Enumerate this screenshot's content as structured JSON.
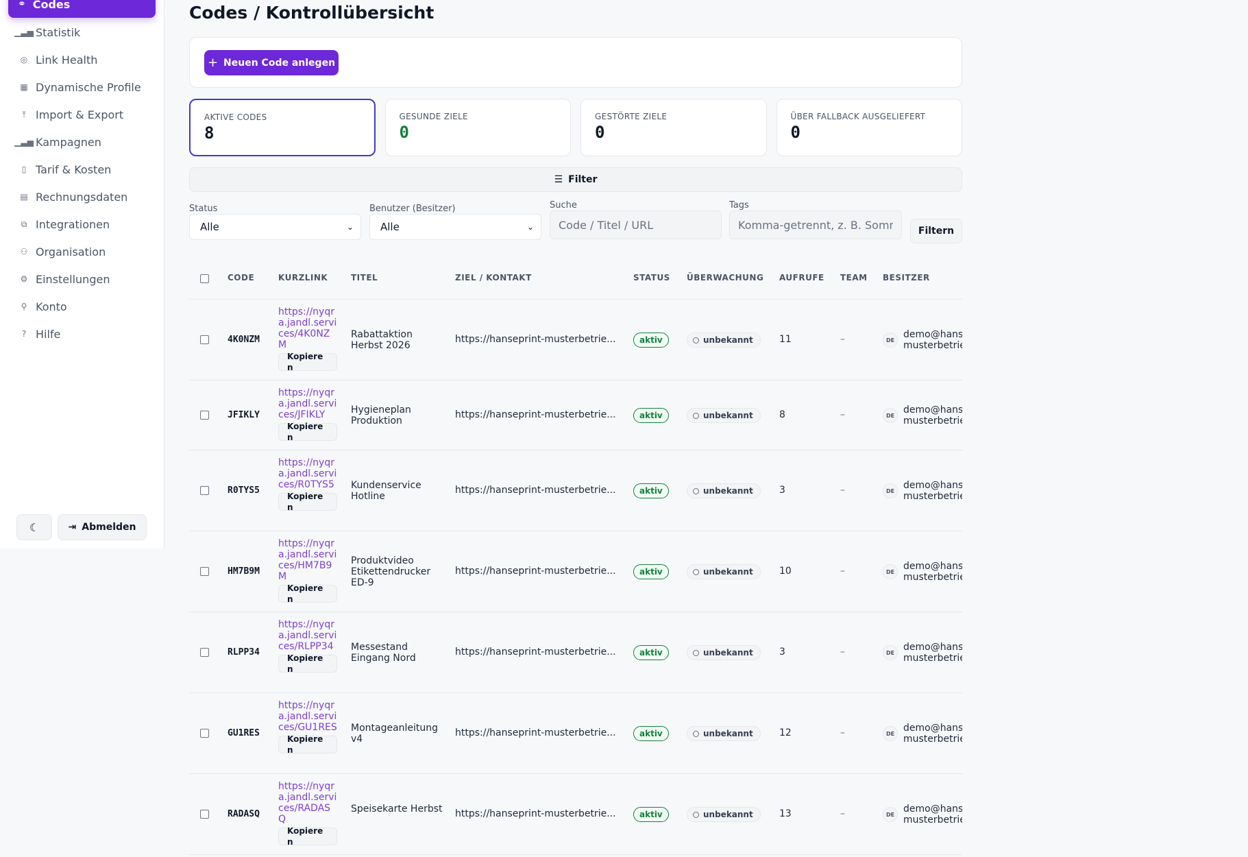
{
  "sidebar": {
    "active": {
      "label": "Codes",
      "icon": "link-icon"
    },
    "items": [
      {
        "label": "Statistik",
        "icon": "bar-chart-icon",
        "glyph": "▁▃▅"
      },
      {
        "label": "Link Health",
        "icon": "map-pin-icon",
        "glyph": "◎"
      },
      {
        "label": "Dynamische Profile",
        "icon": "grid-icon",
        "glyph": "▦"
      },
      {
        "label": "Import & Export",
        "icon": "upload-icon",
        "glyph": "⤒"
      },
      {
        "label": "Kampagnen",
        "icon": "bar-chart-icon",
        "glyph": "▁▃▅"
      },
      {
        "label": "Tarif & Kosten",
        "icon": "building-icon",
        "glyph": "▯"
      },
      {
        "label": "Rechnungsdaten",
        "icon": "document-icon",
        "glyph": "▤"
      },
      {
        "label": "Integrationen",
        "icon": "external-link-icon",
        "glyph": "⧉"
      },
      {
        "label": "Organisation",
        "icon": "users-icon",
        "glyph": "⚇"
      },
      {
        "label": "Einstellungen",
        "icon": "gear-icon",
        "glyph": "⚙"
      },
      {
        "label": "Konto",
        "icon": "user-icon",
        "glyph": "⚲"
      },
      {
        "label": "Hilfe",
        "icon": "help-icon",
        "glyph": "?"
      }
    ],
    "logout_label": "Abmelden"
  },
  "page": {
    "title": "Codes / Kontrollübersicht",
    "new_code_label": "Neuen Code anlegen"
  },
  "kpis": [
    {
      "label": "AKTIVE CODES",
      "value": "8"
    },
    {
      "label": "GESUNDE ZIELE",
      "value": "0"
    },
    {
      "label": "GESTÖRTE ZIELE",
      "value": "0"
    },
    {
      "label": "ÜBER FALLBACK AUSGELIEFERT",
      "value": "0"
    }
  ],
  "filter": {
    "toggle_label": "Filter",
    "status_label": "Status",
    "status_value": "Alle",
    "owner_label": "Benutzer (Besitzer)",
    "owner_value": "Alle",
    "search_label": "Suche",
    "search_placeholder": "Code / Titel / URL",
    "tags_label": "Tags",
    "tags_placeholder": "Komma-getrennt, z. B. Sommer",
    "submit_label": "Filtern"
  },
  "table": {
    "headers": [
      "CODE",
      "KURZLINK",
      "TITEL",
      "ZIEL / KONTAKT",
      "STATUS",
      "ÜBERWACHUNG",
      "AUFRUFE",
      "TEAM",
      "BESITZER"
    ],
    "copy_label": "Kopieren",
    "rows": [
      {
        "code": "4K0NZM",
        "link": "https://nyqra.jandl.services/4K0NZM",
        "title": "Rabattaktion Herbst 2026",
        "target": "https://hanseprint-musterbetrie...",
        "status": "aktiv",
        "monitoring": "unbekannt",
        "calls": "11",
        "team": "–",
        "owner_badge": "DE",
        "owner_line1": "demo@hans",
        "owner_line2": "musterbetrie"
      },
      {
        "code": "JFIKLY",
        "link": "https://nyqra.jandl.services/JFIKLY",
        "title": "Hygieneplan Produktion",
        "target": "https://hanseprint-musterbetrie...",
        "status": "aktiv",
        "monitoring": "unbekannt",
        "calls": "8",
        "team": "–",
        "owner_badge": "DE",
        "owner_line1": "demo@hans",
        "owner_line2": "musterbetrie"
      },
      {
        "code": "R0TYS5",
        "link": "https://nyqra.jandl.services/R0TYS5",
        "title": "Kundenservice Hotline",
        "target": "https://hanseprint-musterbetrie...",
        "status": "aktiv",
        "monitoring": "unbekannt",
        "calls": "3",
        "team": "–",
        "owner_badge": "DE",
        "owner_line1": "demo@hans",
        "owner_line2": "musterbetrie"
      },
      {
        "code": "HM7B9M",
        "link": "https://nyqra.jandl.services/HM7B9M",
        "title": "Produktvideo Etikettendrucker ED-9",
        "target": "https://hanseprint-musterbetrie...",
        "status": "aktiv",
        "monitoring": "unbekannt",
        "calls": "10",
        "team": "–",
        "owner_badge": "DE",
        "owner_line1": "demo@hans",
        "owner_line2": "musterbetrie"
      },
      {
        "code": "RLPP34",
        "link": "https://nyqra.jandl.services/RLPP34",
        "title": "Messestand Eingang Nord",
        "target": "https://hanseprint-musterbetrie...",
        "status": "aktiv",
        "monitoring": "unbekannt",
        "calls": "3",
        "team": "–",
        "owner_badge": "DE",
        "owner_line1": "demo@hans",
        "owner_line2": "musterbetrie"
      },
      {
        "code": "GU1RES",
        "link": "https://nyqra.jandl.services/GU1RES",
        "title": "Montageanleitung v4",
        "target": "https://hanseprint-musterbetrie...",
        "status": "aktiv",
        "monitoring": "unbekannt",
        "calls": "12",
        "team": "–",
        "owner_badge": "DE",
        "owner_line1": "demo@hans",
        "owner_line2": "musterbetrie"
      },
      {
        "code": "RADASQ",
        "link": "https://nyqra.jandl.services/RADASQ",
        "title": "Speisekarte Herbst",
        "target": "https://hanseprint-musterbetrie...",
        "status": "aktiv",
        "monitoring": "unbekannt",
        "calls": "13",
        "team": "–",
        "owner_badge": "DE",
        "owner_line1": "demo@hans",
        "owner_line2": "musterbetrie"
      }
    ]
  },
  "colors": {
    "accent": "#6d28d9",
    "link": "#7e3fd0",
    "status_green": "#15803d"
  }
}
